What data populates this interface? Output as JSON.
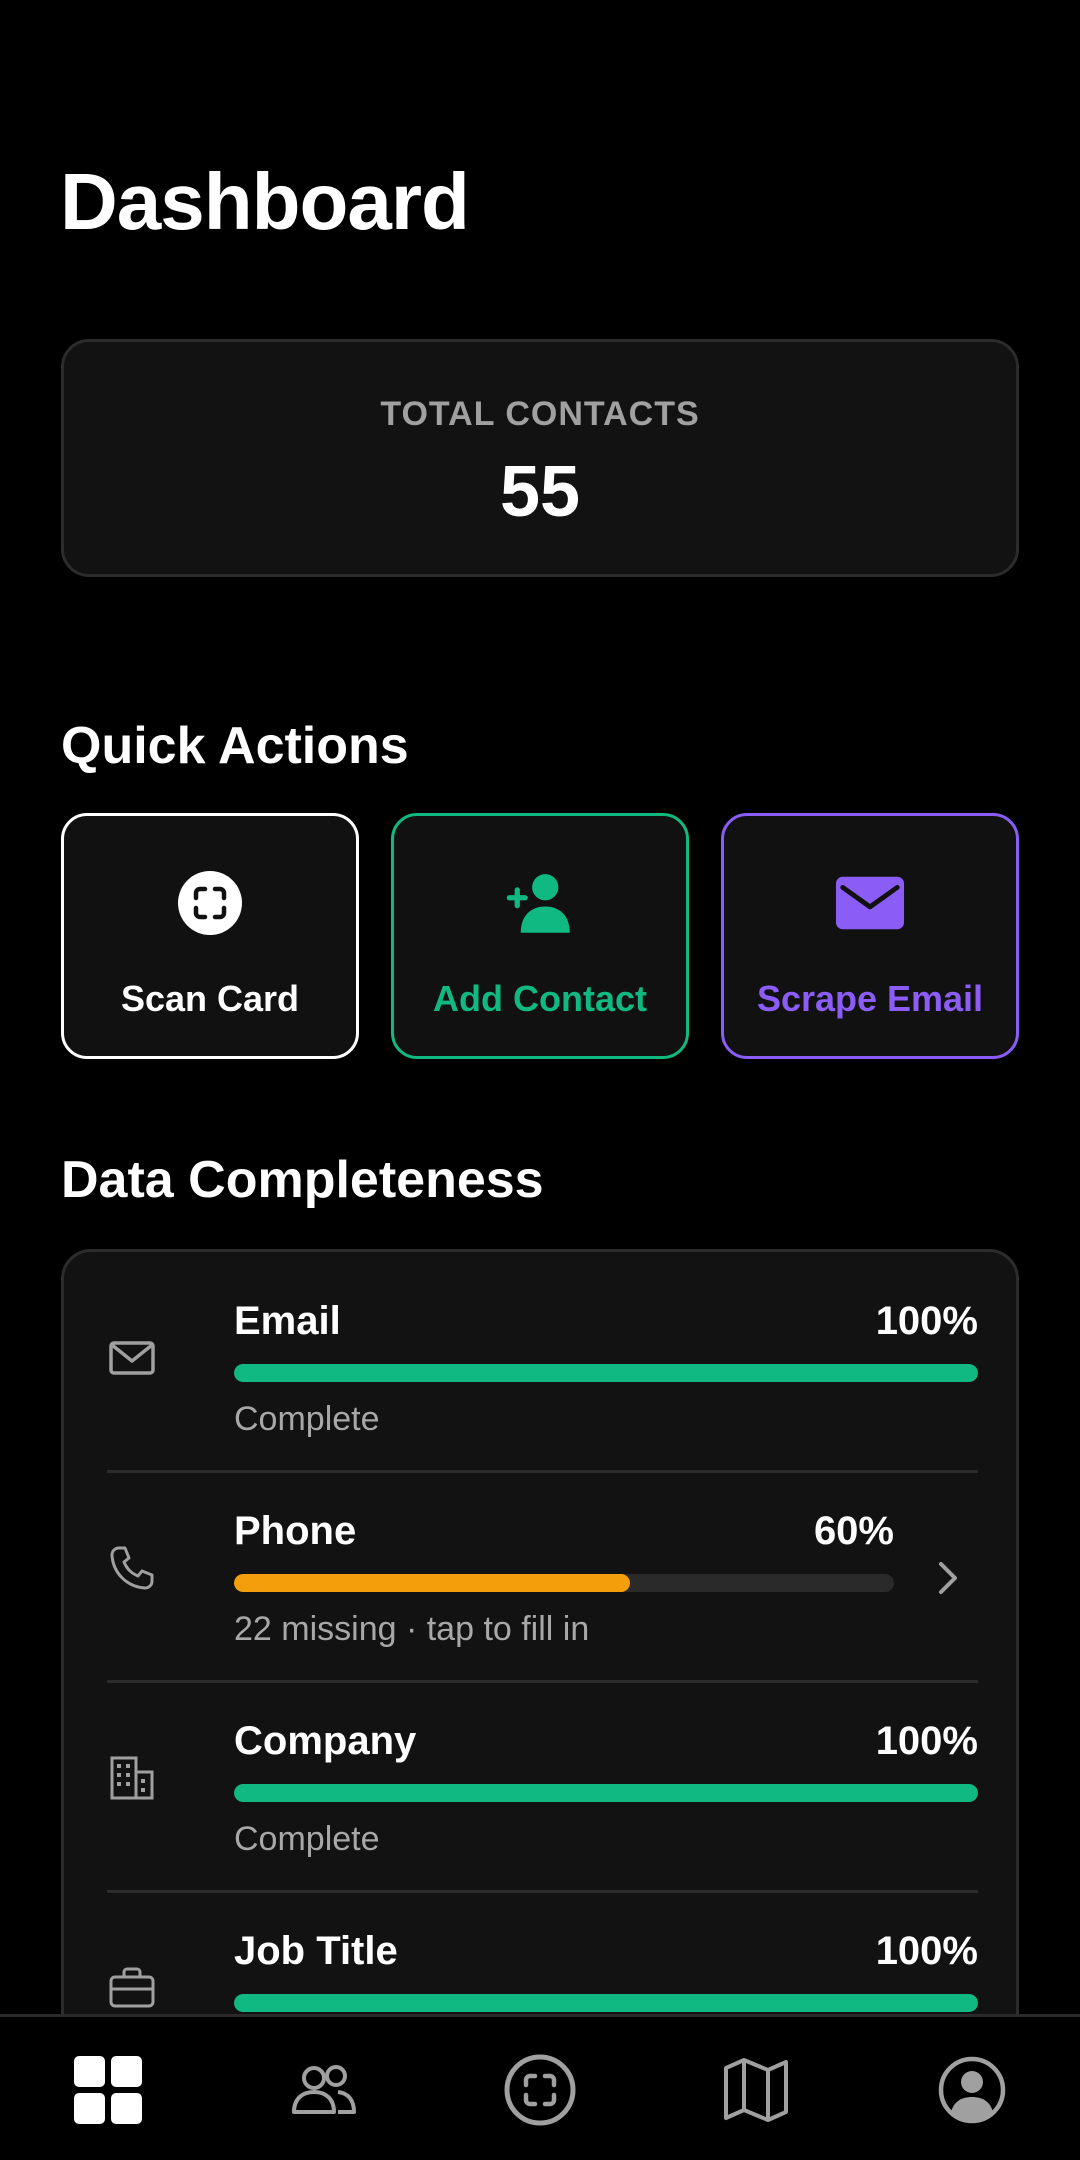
{
  "page": {
    "title": "Dashboard"
  },
  "stats": {
    "total_label": "TOTAL CONTACTS",
    "total_value": "55"
  },
  "quick_actions": {
    "title": "Quick Actions",
    "items": [
      {
        "label": "Scan Card",
        "icon": "scan-icon",
        "color": "#ffffff"
      },
      {
        "label": "Add Contact",
        "icon": "add-person-icon",
        "color": "#10b981"
      },
      {
        "label": "Scrape Email",
        "icon": "mail-icon",
        "color": "#8b5cf6"
      }
    ]
  },
  "completeness": {
    "title": "Data Completeness",
    "rows": [
      {
        "name": "Email",
        "percent": "100%",
        "fill": 1.0,
        "status": "Complete",
        "icon": "envelope-icon",
        "color": "#10b981",
        "chevron": false
      },
      {
        "name": "Phone",
        "percent": "60%",
        "fill": 0.6,
        "status": "22 missing · tap to fill in",
        "icon": "phone-icon",
        "color": "#f59e0b",
        "chevron": true
      },
      {
        "name": "Company",
        "percent": "100%",
        "fill": 1.0,
        "status": "Complete",
        "icon": "building-icon",
        "color": "#10b981",
        "chevron": false
      },
      {
        "name": "Job Title",
        "percent": "100%",
        "fill": 1.0,
        "status": "",
        "icon": "briefcase-icon",
        "color": "#10b981",
        "chevron": false
      }
    ]
  },
  "tabbar": {
    "active": "dashboard",
    "items": [
      {
        "id": "dashboard",
        "icon": "grid-icon"
      },
      {
        "id": "contacts",
        "icon": "people-icon"
      },
      {
        "id": "scan",
        "icon": "scan-icon"
      },
      {
        "id": "map",
        "icon": "map-icon"
      },
      {
        "id": "profile",
        "icon": "user-circle-icon"
      }
    ]
  }
}
